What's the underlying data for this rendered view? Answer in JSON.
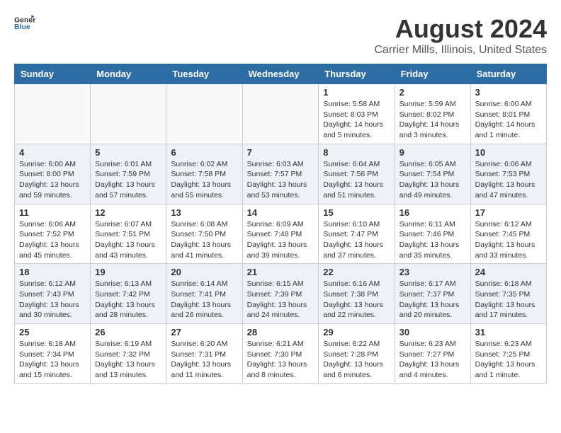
{
  "header": {
    "logo_general": "General",
    "logo_blue": "Blue",
    "month_year": "August 2024",
    "location": "Carrier Mills, Illinois, United States"
  },
  "weekdays": [
    "Sunday",
    "Monday",
    "Tuesday",
    "Wednesday",
    "Thursday",
    "Friday",
    "Saturday"
  ],
  "weeks": [
    [
      {
        "day": "",
        "info": ""
      },
      {
        "day": "",
        "info": ""
      },
      {
        "day": "",
        "info": ""
      },
      {
        "day": "",
        "info": ""
      },
      {
        "day": "1",
        "info": "Sunrise: 5:58 AM\nSunset: 8:03 PM\nDaylight: 14 hours\nand 5 minutes."
      },
      {
        "day": "2",
        "info": "Sunrise: 5:59 AM\nSunset: 8:02 PM\nDaylight: 14 hours\nand 3 minutes."
      },
      {
        "day": "3",
        "info": "Sunrise: 6:00 AM\nSunset: 8:01 PM\nDaylight: 14 hours\nand 1 minute."
      }
    ],
    [
      {
        "day": "4",
        "info": "Sunrise: 6:00 AM\nSunset: 8:00 PM\nDaylight: 13 hours\nand 59 minutes."
      },
      {
        "day": "5",
        "info": "Sunrise: 6:01 AM\nSunset: 7:59 PM\nDaylight: 13 hours\nand 57 minutes."
      },
      {
        "day": "6",
        "info": "Sunrise: 6:02 AM\nSunset: 7:58 PM\nDaylight: 13 hours\nand 55 minutes."
      },
      {
        "day": "7",
        "info": "Sunrise: 6:03 AM\nSunset: 7:57 PM\nDaylight: 13 hours\nand 53 minutes."
      },
      {
        "day": "8",
        "info": "Sunrise: 6:04 AM\nSunset: 7:56 PM\nDaylight: 13 hours\nand 51 minutes."
      },
      {
        "day": "9",
        "info": "Sunrise: 6:05 AM\nSunset: 7:54 PM\nDaylight: 13 hours\nand 49 minutes."
      },
      {
        "day": "10",
        "info": "Sunrise: 6:06 AM\nSunset: 7:53 PM\nDaylight: 13 hours\nand 47 minutes."
      }
    ],
    [
      {
        "day": "11",
        "info": "Sunrise: 6:06 AM\nSunset: 7:52 PM\nDaylight: 13 hours\nand 45 minutes."
      },
      {
        "day": "12",
        "info": "Sunrise: 6:07 AM\nSunset: 7:51 PM\nDaylight: 13 hours\nand 43 minutes."
      },
      {
        "day": "13",
        "info": "Sunrise: 6:08 AM\nSunset: 7:50 PM\nDaylight: 13 hours\nand 41 minutes."
      },
      {
        "day": "14",
        "info": "Sunrise: 6:09 AM\nSunset: 7:48 PM\nDaylight: 13 hours\nand 39 minutes."
      },
      {
        "day": "15",
        "info": "Sunrise: 6:10 AM\nSunset: 7:47 PM\nDaylight: 13 hours\nand 37 minutes."
      },
      {
        "day": "16",
        "info": "Sunrise: 6:11 AM\nSunset: 7:46 PM\nDaylight: 13 hours\nand 35 minutes."
      },
      {
        "day": "17",
        "info": "Sunrise: 6:12 AM\nSunset: 7:45 PM\nDaylight: 13 hours\nand 33 minutes."
      }
    ],
    [
      {
        "day": "18",
        "info": "Sunrise: 6:12 AM\nSunset: 7:43 PM\nDaylight: 13 hours\nand 30 minutes."
      },
      {
        "day": "19",
        "info": "Sunrise: 6:13 AM\nSunset: 7:42 PM\nDaylight: 13 hours\nand 28 minutes."
      },
      {
        "day": "20",
        "info": "Sunrise: 6:14 AM\nSunset: 7:41 PM\nDaylight: 13 hours\nand 26 minutes."
      },
      {
        "day": "21",
        "info": "Sunrise: 6:15 AM\nSunset: 7:39 PM\nDaylight: 13 hours\nand 24 minutes."
      },
      {
        "day": "22",
        "info": "Sunrise: 6:16 AM\nSunset: 7:38 PM\nDaylight: 13 hours\nand 22 minutes."
      },
      {
        "day": "23",
        "info": "Sunrise: 6:17 AM\nSunset: 7:37 PM\nDaylight: 13 hours\nand 20 minutes."
      },
      {
        "day": "24",
        "info": "Sunrise: 6:18 AM\nSunset: 7:35 PM\nDaylight: 13 hours\nand 17 minutes."
      }
    ],
    [
      {
        "day": "25",
        "info": "Sunrise: 6:18 AM\nSunset: 7:34 PM\nDaylight: 13 hours\nand 15 minutes."
      },
      {
        "day": "26",
        "info": "Sunrise: 6:19 AM\nSunset: 7:32 PM\nDaylight: 13 hours\nand 13 minutes."
      },
      {
        "day": "27",
        "info": "Sunrise: 6:20 AM\nSunset: 7:31 PM\nDaylight: 13 hours\nand 11 minutes."
      },
      {
        "day": "28",
        "info": "Sunrise: 6:21 AM\nSunset: 7:30 PM\nDaylight: 13 hours\nand 8 minutes."
      },
      {
        "day": "29",
        "info": "Sunrise: 6:22 AM\nSunset: 7:28 PM\nDaylight: 13 hours\nand 6 minutes."
      },
      {
        "day": "30",
        "info": "Sunrise: 6:23 AM\nSunset: 7:27 PM\nDaylight: 13 hours\nand 4 minutes."
      },
      {
        "day": "31",
        "info": "Sunrise: 6:23 AM\nSunset: 7:25 PM\nDaylight: 13 hours\nand 1 minute."
      }
    ]
  ]
}
